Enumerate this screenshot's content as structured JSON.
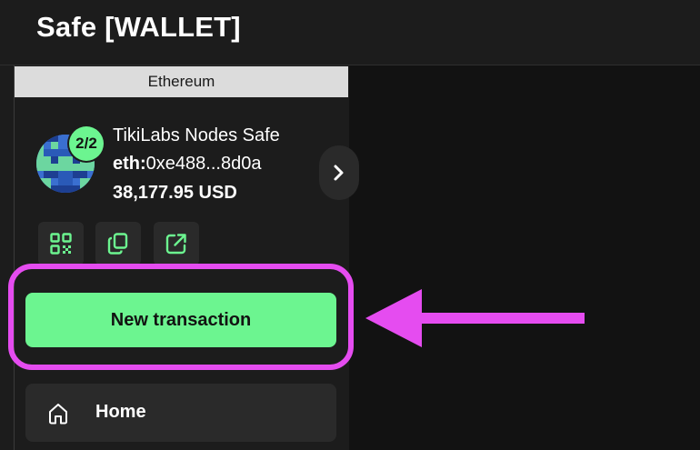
{
  "header": {
    "title": "Safe [WALLET]"
  },
  "network": {
    "name": "Ethereum"
  },
  "safe": {
    "threshold": "2/2",
    "name": "TikiLabs Nodes Safe",
    "address_prefix": "eth:",
    "address": "0xe488...8d0a",
    "balance": "38,177.95 USD"
  },
  "actions": [
    {
      "icon": "qr-code-icon"
    },
    {
      "icon": "copy-icon"
    },
    {
      "icon": "external-link-icon"
    }
  ],
  "new_transaction": {
    "label": "New transaction"
  },
  "nav": {
    "home_label": "Home"
  },
  "colors": {
    "accent": "#6cf590",
    "highlight": "#e54cf0",
    "background": "#1c1c1c",
    "main_background": "#121212",
    "surface": "#2a2a2a"
  }
}
